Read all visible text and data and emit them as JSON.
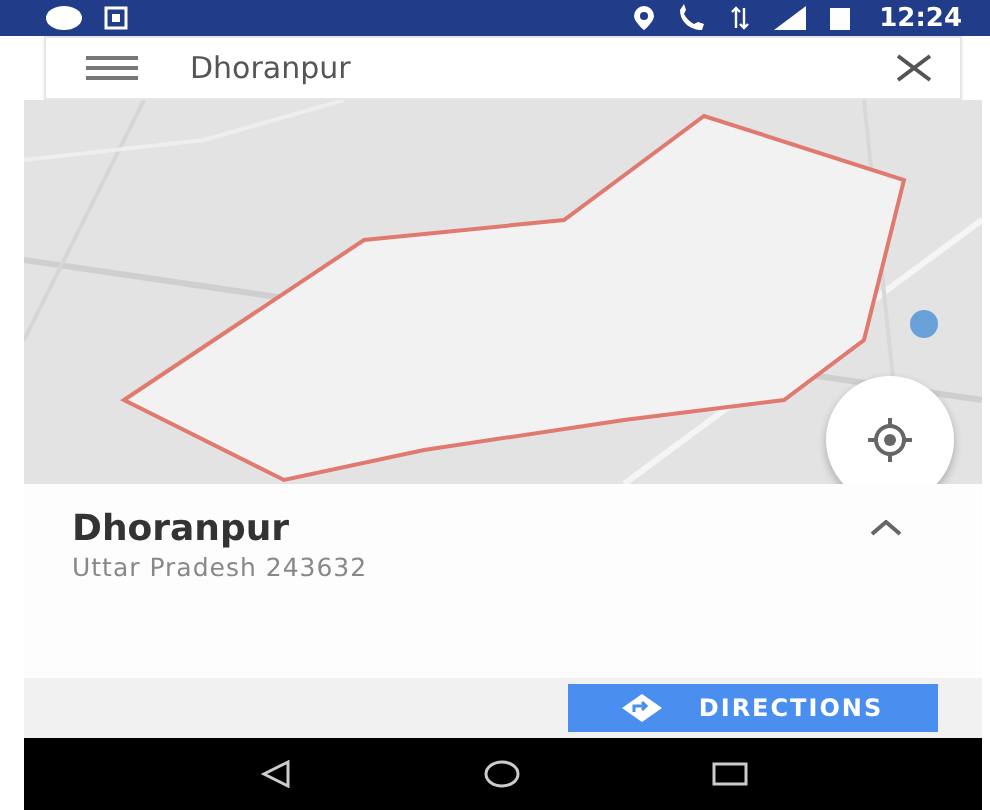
{
  "status_bar": {
    "time": "12:24"
  },
  "search": {
    "value": "Dhoranpur"
  },
  "place": {
    "name": "Dhoranpur",
    "address": "Uttar Pradesh 243632"
  },
  "actions": [
    {
      "label": "DIRECTIONS"
    }
  ]
}
